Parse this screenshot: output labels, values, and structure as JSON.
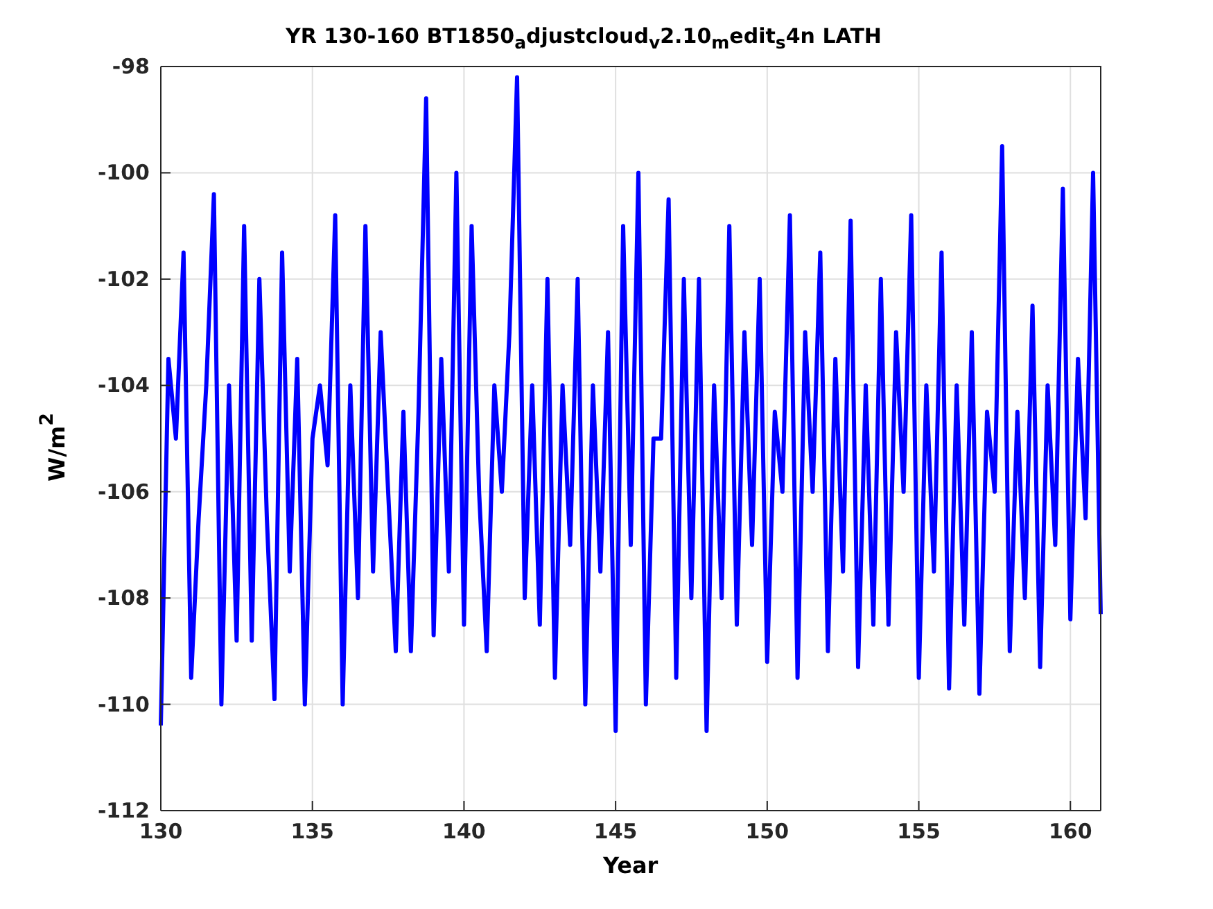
{
  "figure": {
    "chart_data": {
      "type": "line",
      "grid": true,
      "title": "YR 130-160 BT1850$_{a}$djustcloud$_{v}$2.10$_{m}$edit$_{s}$4n LATH",
      "xlabel": "Year",
      "ylabel": "W/m$^{2}$",
      "xlim": [
        130,
        161
      ],
      "ylim": [
        -112,
        -98
      ],
      "xticks": [
        130,
        135,
        140,
        145,
        150,
        155,
        160
      ],
      "yticks": [
        -112,
        -110,
        -108,
        -106,
        -104,
        -102,
        -100,
        -98
      ],
      "x": [
        130,
        130.25,
        130.5,
        130.75,
        131,
        131.25,
        131.5,
        131.75,
        132,
        132.25,
        132.5,
        132.75,
        133,
        133.25,
        133.5,
        133.75,
        134,
        134.25,
        134.5,
        134.75,
        135,
        135.25,
        135.5,
        135.75,
        136,
        136.25,
        136.5,
        136.75,
        137,
        137.25,
        137.5,
        137.75,
        138,
        138.25,
        138.5,
        138.75,
        139,
        139.25,
        139.5,
        139.75,
        140,
        140.25,
        140.5,
        140.75,
        141,
        141.25,
        141.5,
        141.75,
        142,
        142.25,
        142.5,
        142.75,
        143,
        143.25,
        143.5,
        143.75,
        144,
        144.25,
        144.5,
        144.75,
        145,
        145.25,
        145.5,
        145.75,
        146,
        146.25,
        146.5,
        146.75,
        147,
        147.25,
        147.5,
        147.75,
        148,
        148.25,
        148.5,
        148.75,
        149,
        149.25,
        149.5,
        149.75,
        150,
        150.25,
        150.5,
        150.75,
        151,
        151.25,
        151.5,
        151.75,
        152,
        152.25,
        152.5,
        152.75,
        153,
        153.25,
        153.5,
        153.75,
        154,
        154.25,
        154.5,
        154.75,
        155,
        155.25,
        155.5,
        155.75,
        156,
        156.25,
        156.5,
        156.75,
        157,
        157.25,
        157.5,
        157.75,
        158,
        158.25,
        158.5,
        158.75,
        159,
        159.25,
        159.5,
        159.75,
        160,
        160.25,
        160.5,
        160.75,
        161
      ],
      "series": [
        {
          "color": "#0000ff",
          "values": [
            -110.4,
            -103.5,
            -105,
            -101.5,
            -109.5,
            -106.5,
            -104,
            -100.4,
            -110,
            -104,
            -108.8,
            -101,
            -108.8,
            -102,
            -106.5,
            -109.9,
            -101.5,
            -107.5,
            -103.5,
            -110,
            -105,
            -104,
            -105.5,
            -100.8,
            -110,
            -104,
            -108,
            -101,
            -107.5,
            -103,
            -106,
            -109,
            -104.5,
            -109,
            -104.5,
            -98.6,
            -108.7,
            -103.5,
            -107.5,
            -100,
            -108.5,
            -101,
            -106,
            -109,
            -104,
            -106,
            -103,
            -98.2,
            -108,
            -104,
            -108.5,
            -102,
            -109.5,
            -104,
            -107,
            -102,
            -110,
            -104,
            -107.5,
            -103,
            -110.5,
            -101,
            -107,
            -100,
            -110,
            -105,
            -105,
            -100.5,
            -109.5,
            -102,
            -108,
            -102,
            -110.5,
            -104,
            -108,
            -101,
            -108.5,
            -103,
            -107,
            -102,
            -109.2,
            -104.5,
            -106,
            -100.8,
            -109.5,
            -103,
            -106,
            -101.5,
            -109,
            -103.5,
            -107.5,
            -100.9,
            -109.3,
            -104,
            -108.5,
            -102,
            -108.5,
            -103,
            -106,
            -100.8,
            -109.5,
            -104,
            -107.5,
            -101.5,
            -109.7,
            -104,
            -108.5,
            -103,
            -109.8,
            -104.5,
            -106,
            -99.5,
            -109,
            -104.5,
            -108,
            -102.5,
            -109.3,
            -104,
            -107,
            -100.3,
            -108.4,
            -103.5,
            -106.5,
            -100,
            -108.3
          ]
        }
      ]
    }
  }
}
